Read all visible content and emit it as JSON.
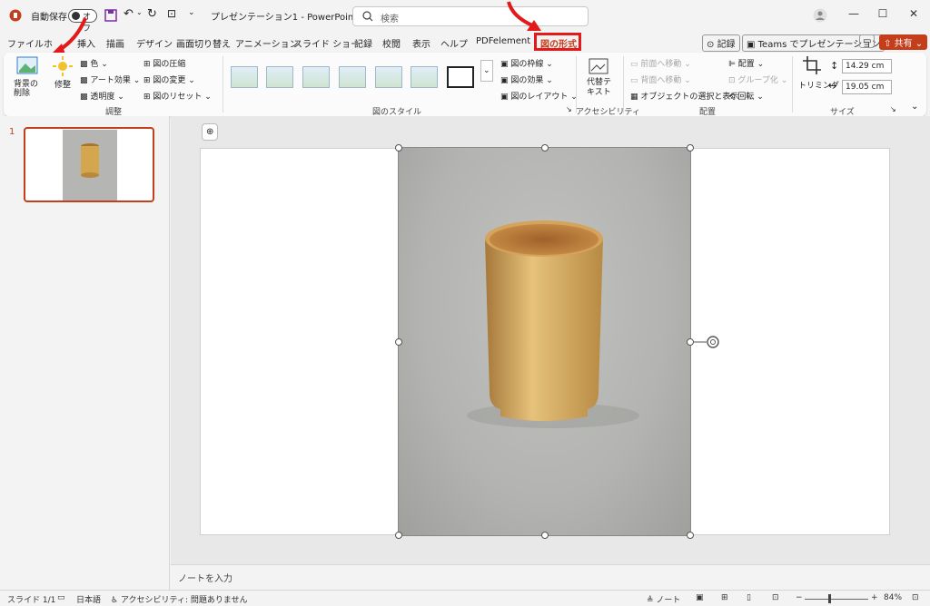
{
  "titlebar": {
    "autosave_label": "自動保存",
    "autosave_state": "オフ",
    "doc_title": "プレゼンテーション1 - PowerPoint",
    "search_placeholder": "検索"
  },
  "tabs": [
    "ファイル",
    "ホ",
    "挿入",
    "描画",
    "デザイン",
    "画面切り替え",
    "アニメーション",
    "スライド ショー",
    "記録",
    "校閲",
    "表示",
    "ヘルプ",
    "PDFelement",
    "図の形式"
  ],
  "tab_right": {
    "record": "記録",
    "teams": "Teams でプレゼンテーション",
    "share": "共有"
  },
  "ribbon": {
    "remove_bg": "背景の削除",
    "corrections": "修整",
    "color": "色",
    "artistic": "アート効果",
    "transparency": "透明度",
    "compress": "図の圧縮",
    "change": "図の変更",
    "reset": "図のリセット",
    "adjust_group": "調整",
    "styles_group": "図のスタイル",
    "border": "図の枠線",
    "effects": "図の効果",
    "layout": "図のレイアウト",
    "alt_text": "代替テキスト",
    "access_group": "アクセシビリティ",
    "bring_forward": "前面へ移動",
    "send_backward": "背面へ移動",
    "selection_pane": "オブジェクトの選択と表示",
    "align": "配置",
    "group": "グループ化",
    "rotate": "回転",
    "arrange_group": "配置",
    "crop": "トリミング",
    "height": "14.29 cm",
    "width": "19.05 cm",
    "size_group": "サイズ"
  },
  "slide_panel": {
    "number": "1"
  },
  "notes": {
    "placeholder": "ノートを入力"
  },
  "status": {
    "slide": "スライド 1/1",
    "language": "日本語",
    "accessibility": "アクセシビリティ: 問題ありません",
    "notes_btn": "ノート",
    "zoom": "84%"
  },
  "colors": {
    "accent": "#c43e1c",
    "highlight": "#e21a1a"
  }
}
